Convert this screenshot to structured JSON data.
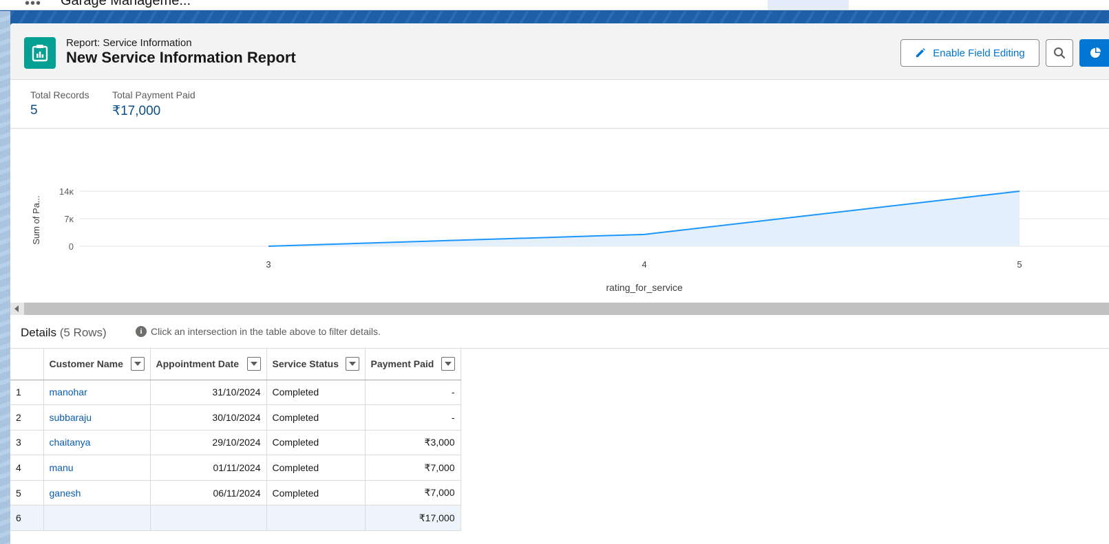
{
  "nav": {
    "app_name": "Garage Manageme..."
  },
  "header": {
    "eyebrow": "Report: Service Information",
    "title": "New Service Information Report",
    "enable_editing_label": "Enable Field Editing"
  },
  "summary": {
    "total_records_label": "Total Records",
    "total_records_value": "5",
    "total_paid_label": "Total Payment Paid",
    "total_paid_value": "₹17,000"
  },
  "chart_data": {
    "type": "area",
    "x": [
      "3",
      "4",
      "5"
    ],
    "series": [
      {
        "values": [
          0,
          3000,
          14000
        ]
      }
    ],
    "xlabel": "rating_for_service",
    "ylabel": "Sum of Pa...",
    "yticks": [
      "0",
      "7ĸ",
      "14ĸ"
    ],
    "ytick_values": [
      0,
      7000,
      14000
    ],
    "ylim": [
      0,
      14000
    ],
    "grid": true,
    "colors": {
      "line": "#1b96ff",
      "fill": "#e3f0fc"
    }
  },
  "details": {
    "title": "Details",
    "row_count": "(5 Rows)",
    "hint": "Click an intersection in the table above to filter details."
  },
  "table": {
    "columns": [
      "Customer Name",
      "Appointment Date",
      "Service Status",
      "Payment Paid"
    ],
    "rows": [
      {
        "n": "1",
        "name": "manohar",
        "date": "31/10/2024",
        "status": "Completed",
        "paid": "-"
      },
      {
        "n": "2",
        "name": "subbaraju",
        "date": "30/10/2024",
        "status": "Completed",
        "paid": "-"
      },
      {
        "n": "3",
        "name": "chaitanya",
        "date": "29/10/2024",
        "status": "Completed",
        "paid": "₹3,000"
      },
      {
        "n": "4",
        "name": "manu",
        "date": "01/11/2024",
        "status": "Completed",
        "paid": "₹7,000"
      },
      {
        "n": "5",
        "name": "ganesh",
        "date": "06/11/2024",
        "status": "Completed",
        "paid": "₹7,000"
      }
    ],
    "total": {
      "n": "6",
      "paid": "₹17,000"
    }
  }
}
